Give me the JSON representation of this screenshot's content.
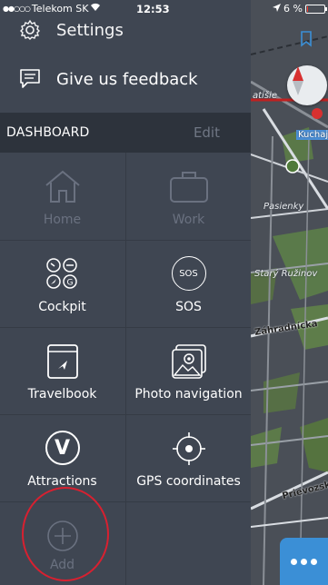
{
  "status_bar": {
    "signal": "●●○○○",
    "carrier": "Telekom SK",
    "time": "12:53",
    "battery": "6 %",
    "battery_level": 0.06
  },
  "menu": {
    "settings_label": "Settings",
    "feedback_label": "Give us feedback"
  },
  "dashboard": {
    "title": "DASHBOARD",
    "edit_label": "Edit",
    "tiles": [
      {
        "label": "Home",
        "icon": "home-icon",
        "enabled": false
      },
      {
        "label": "Work",
        "icon": "briefcase-icon",
        "enabled": false
      },
      {
        "label": "Cockpit",
        "icon": "cockpit-icon",
        "enabled": true
      },
      {
        "label": "SOS",
        "icon": "sos-icon",
        "enabled": true
      },
      {
        "label": "Travelbook",
        "icon": "travelbook-icon",
        "enabled": true
      },
      {
        "label": "Photo navigation",
        "icon": "photo-icon",
        "enabled": true
      },
      {
        "label": "Attractions",
        "icon": "attractions-icon",
        "enabled": true
      },
      {
        "label": "GPS coordinates",
        "icon": "gps-icon",
        "enabled": true
      },
      {
        "label": "Add",
        "icon": "plus-icon",
        "enabled": false
      }
    ],
    "sos_icon_text": "SOS",
    "attractions_icon_text": "V"
  },
  "map": {
    "labels": [
      "atišie",
      "Kuchajd",
      "Pasienky",
      "Starý Ružinov",
      "Záhradnícka",
      "Prievozská"
    ]
  },
  "colors": {
    "drawer": "#3f4652",
    "header": "#2d333c",
    "accent": "#3b8fd6",
    "annotation": "#d82030"
  }
}
